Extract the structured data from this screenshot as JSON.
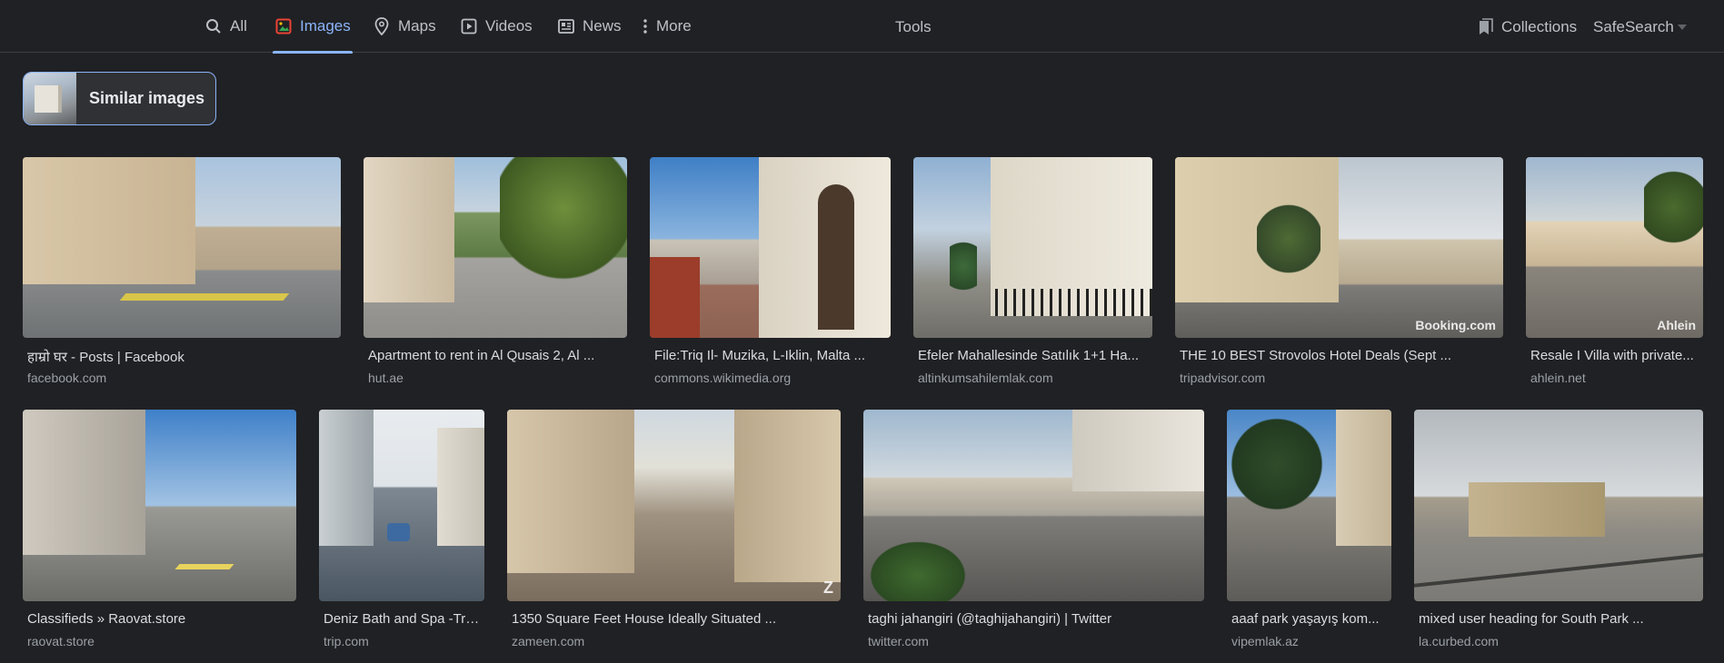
{
  "nav": {
    "tabs": [
      {
        "label": "All",
        "icon": "search-icon",
        "active": false
      },
      {
        "label": "Images",
        "icon": "images-icon",
        "active": true
      },
      {
        "label": "Maps",
        "icon": "map-pin-icon",
        "active": false
      },
      {
        "label": "Videos",
        "icon": "video-play-icon",
        "active": false
      },
      {
        "label": "News",
        "icon": "news-icon",
        "active": false
      },
      {
        "label": "More",
        "icon": "more-vert-icon",
        "active": false
      }
    ],
    "tools": "Tools",
    "collections": "Collections",
    "safesearch": "SafeSearch"
  },
  "similar": {
    "label": "Similar images"
  },
  "results": [
    {
      "title": "हाम्रो घर - Posts | Facebook",
      "source": "facebook.com"
    },
    {
      "title": "Apartment to rent in Al Qusais 2, Al ...",
      "source": "hut.ae"
    },
    {
      "title": "File:Triq Il- Muzika, L-Iklin, Malta ...",
      "source": "commons.wikimedia.org"
    },
    {
      "title": "Efeler Mahallesinde Satılık 1+1 Ha...",
      "source": "altinkumsahilemlak.com"
    },
    {
      "title": "THE 10 BEST Strovolos Hotel Deals (Sept ...",
      "source": "tripadvisor.com",
      "watermark": "Booking.com"
    },
    {
      "title": "Resale I Villa with private...",
      "source": "ahlein.net",
      "watermark": "Ahlein"
    },
    {
      "title": "Classifieds » Raovat.store",
      "source": "raovat.store"
    },
    {
      "title": "Deniz Bath and Spa -Tri...",
      "source": "trip.com"
    },
    {
      "title": "1350 Square Feet House Ideally Situated ...",
      "source": "zameen.com",
      "watermark": "Z"
    },
    {
      "title": "taghi jahangiri (@taghijahangiri) | Twitter",
      "source": "twitter.com"
    },
    {
      "title": "aaaf park yaşayış kom...",
      "source": "vipemlak.az"
    },
    {
      "title": "mixed user heading for South Park ...",
      "source": "la.curbed.com"
    }
  ]
}
